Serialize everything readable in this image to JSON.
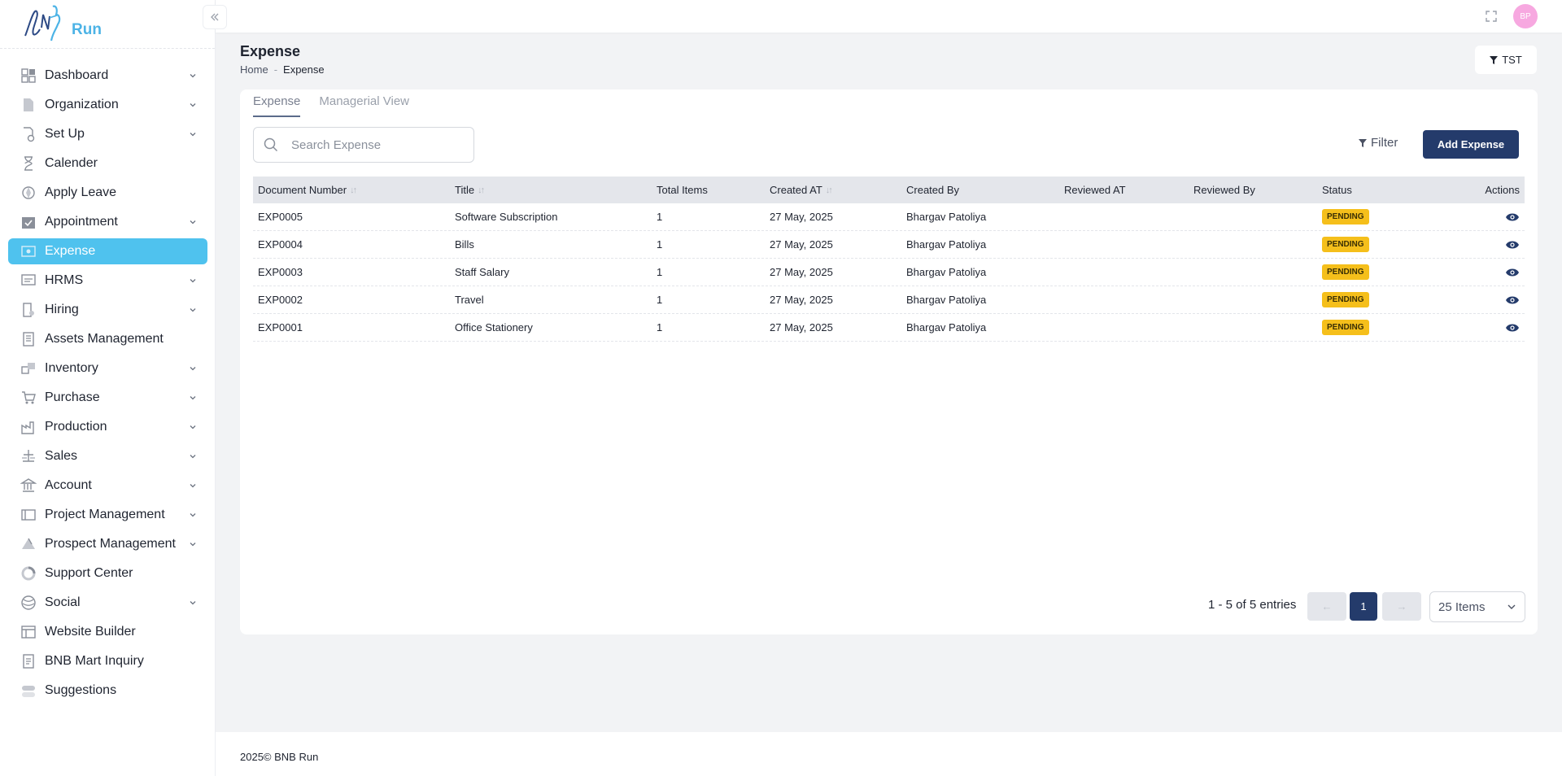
{
  "brand": {
    "logo_text": "BNB",
    "run_text": "Run"
  },
  "sidebar": {
    "items": [
      {
        "label": "Dashboard",
        "icon": "dashboard-icon",
        "chevron": true,
        "active": false
      },
      {
        "label": "Organization",
        "icon": "document-icon",
        "chevron": true,
        "active": false
      },
      {
        "label": "Set Up",
        "icon": "settings-doc-icon",
        "chevron": true,
        "active": false
      },
      {
        "label": "Calender",
        "icon": "hourglass-icon",
        "chevron": false,
        "active": false
      },
      {
        "label": "Apply Leave",
        "icon": "leave-icon",
        "chevron": false,
        "active": false
      },
      {
        "label": "Appointment",
        "icon": "calendar-check-icon",
        "chevron": true,
        "active": false
      },
      {
        "label": "Expense",
        "icon": "expense-icon",
        "chevron": false,
        "active": true
      },
      {
        "label": "HRMS",
        "icon": "hrms-icon",
        "chevron": true,
        "active": false
      },
      {
        "label": "Hiring",
        "icon": "hiring-icon",
        "chevron": true,
        "active": false
      },
      {
        "label": "Assets Management",
        "icon": "assets-icon",
        "chevron": false,
        "active": false
      },
      {
        "label": "Inventory",
        "icon": "inventory-icon",
        "chevron": true,
        "active": false
      },
      {
        "label": "Purchase",
        "icon": "cart-icon",
        "chevron": true,
        "active": false
      },
      {
        "label": "Production",
        "icon": "factory-icon",
        "chevron": true,
        "active": false
      },
      {
        "label": "Sales",
        "icon": "scale-icon",
        "chevron": true,
        "active": false
      },
      {
        "label": "Account",
        "icon": "bank-icon",
        "chevron": true,
        "active": false
      },
      {
        "label": "Project Management",
        "icon": "project-icon",
        "chevron": true,
        "active": false
      },
      {
        "label": "Prospect Management",
        "icon": "prospect-icon",
        "chevron": true,
        "active": false
      },
      {
        "label": "Support Center",
        "icon": "support-icon",
        "chevron": false,
        "active": false
      },
      {
        "label": "Social",
        "icon": "globe-icon",
        "chevron": true,
        "active": false
      },
      {
        "label": "Website Builder",
        "icon": "layout-icon",
        "chevron": false,
        "active": false
      },
      {
        "label": "BNB Mart Inquiry",
        "icon": "inquiry-icon",
        "chevron": false,
        "active": false
      },
      {
        "label": "Suggestions",
        "icon": "toggle-icon",
        "chevron": false,
        "active": false
      }
    ]
  },
  "topbar": {
    "avatar_initials": "BP"
  },
  "page": {
    "title": "Expense",
    "breadcrumb": {
      "home": "Home",
      "sep": "-",
      "current": "Expense"
    },
    "tst_label": "TST"
  },
  "tabs": [
    {
      "label": "Expense",
      "active": true
    },
    {
      "label": "Managerial View",
      "active": false
    }
  ],
  "search": {
    "placeholder": "Search Expense",
    "value": ""
  },
  "filter_label": "Filter",
  "add_button": "Add Expense",
  "table": {
    "columns": [
      "Document Number",
      "Title",
      "Total Items",
      "Created AT",
      "Created By",
      "Reviewed AT",
      "Reviewed By",
      "Status",
      "Actions"
    ],
    "sortable": [
      true,
      true,
      false,
      true,
      false,
      false,
      false,
      false,
      false
    ],
    "rows": [
      {
        "doc": "EXP0005",
        "title": "Software Subscription",
        "total": "1",
        "created_at": "27 May, 2025",
        "created_by": "Bhargav Patoliya",
        "reviewed_at": "",
        "reviewed_by": "",
        "status": "PENDING"
      },
      {
        "doc": "EXP0004",
        "title": "Bills",
        "total": "1",
        "created_at": "27 May, 2025",
        "created_by": "Bhargav Patoliya",
        "reviewed_at": "",
        "reviewed_by": "",
        "status": "PENDING"
      },
      {
        "doc": "EXP0003",
        "title": "Staff Salary",
        "total": "1",
        "created_at": "27 May, 2025",
        "created_by": "Bhargav Patoliya",
        "reviewed_at": "",
        "reviewed_by": "",
        "status": "PENDING"
      },
      {
        "doc": "EXP0002",
        "title": "Travel",
        "total": "1",
        "created_at": "27 May, 2025",
        "created_by": "Bhargav Patoliya",
        "reviewed_at": "",
        "reviewed_by": "",
        "status": "PENDING"
      },
      {
        "doc": "EXP0001",
        "title": "Office Stationery",
        "total": "1",
        "created_at": "27 May, 2025",
        "created_by": "Bhargav Patoliya",
        "reviewed_at": "",
        "reviewed_by": "",
        "status": "PENDING"
      }
    ]
  },
  "pagination": {
    "summary": "1 - 5 of 5 entries",
    "prev": "←",
    "page": "1",
    "next": "→",
    "per_page": "25 Items"
  },
  "footer": {
    "text": "2025© BNB Run"
  },
  "colors": {
    "accent": "#4fc2ee",
    "primary": "#243b6b",
    "pending": "#f5bf1b",
    "avatar": "#f7a8e0"
  }
}
